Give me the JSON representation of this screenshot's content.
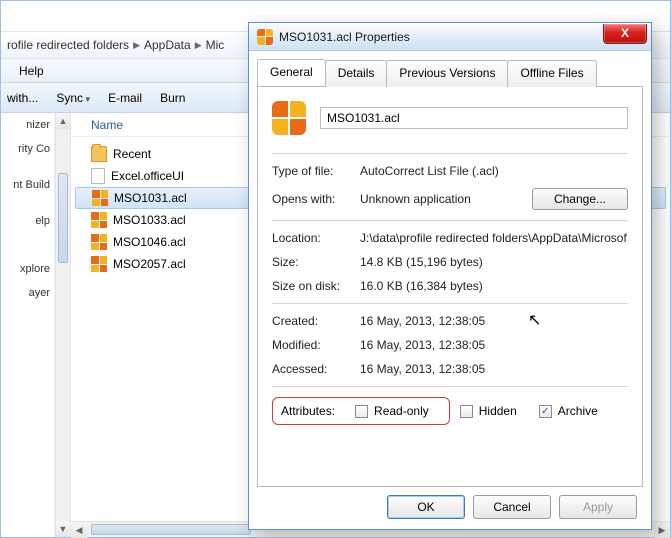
{
  "explorer": {
    "breadcrumb": [
      "rofile redirected folders",
      "AppData",
      "Mic"
    ],
    "menu": {
      "help": "Help"
    },
    "toolbar": {
      "openwith": "with...",
      "sync": "Sync",
      "email": "E-mail",
      "burn": "Burn"
    },
    "sidebar": [
      "nizer",
      "rity Co",
      "",
      "nt Build",
      "",
      "elp",
      "",
      "",
      "xplore",
      "ayer"
    ],
    "columns": {
      "name": "Name"
    },
    "items": [
      {
        "name": "Recent",
        "type": "folder"
      },
      {
        "name": "Excel.officeUI",
        "type": "file"
      },
      {
        "name": "MSO1031.acl",
        "type": "acl",
        "selected": true
      },
      {
        "name": "MSO1033.acl",
        "type": "acl"
      },
      {
        "name": "MSO1046.acl",
        "type": "acl"
      },
      {
        "name": "MSO2057.acl",
        "type": "acl"
      }
    ]
  },
  "dialog": {
    "title": "MSO1031.acl Properties",
    "close": "X",
    "tabs": {
      "general": "General",
      "details": "Details",
      "previous": "Previous Versions",
      "offline": "Offline Files"
    },
    "filename": "MSO1031.acl",
    "labels": {
      "typeoffile": "Type of file:",
      "openswith": "Opens with:",
      "change": "Change...",
      "location": "Location:",
      "size": "Size:",
      "sizeondisk": "Size on disk:",
      "created": "Created:",
      "modified": "Modified:",
      "accessed": "Accessed:",
      "attributes": "Attributes:",
      "readonly": "Read-only",
      "hidden": "Hidden",
      "archive": "Archive"
    },
    "values": {
      "typeoffile": "AutoCorrect List File (.acl)",
      "openswith": "Unknown application",
      "location": "J:\\data\\profile redirected folders\\AppData\\Microsof",
      "size": "14.8 KB (15,196 bytes)",
      "sizeondisk": "16.0 KB (16,384 bytes)",
      "created": "16 May, 2013, 12:38:05",
      "modified": "16 May, 2013, 12:38:05",
      "accessed": "16 May, 2013, 12:38:05"
    },
    "attr": {
      "readonly": false,
      "hidden": false,
      "archive": true
    },
    "buttons": {
      "ok": "OK",
      "cancel": "Cancel",
      "apply": "Apply"
    }
  }
}
